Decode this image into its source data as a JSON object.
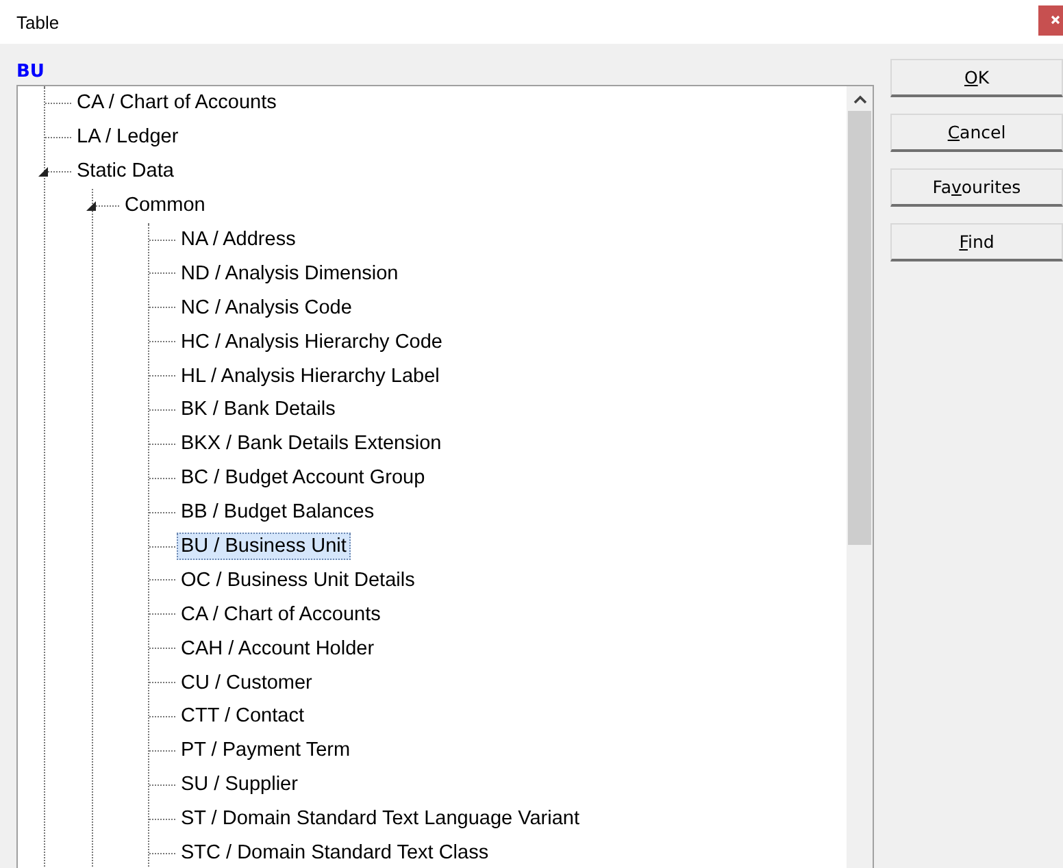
{
  "window": {
    "title": "Table"
  },
  "selection_label": "BU",
  "tree": [
    {
      "label": "CA / Chart of Accounts",
      "selected": false
    },
    {
      "label": "LA / Ledger",
      "selected": false
    },
    {
      "label": "Static Data",
      "selected": false,
      "expanded": true,
      "children": [
        {
          "label": "Common",
          "selected": false,
          "expanded": true,
          "children": [
            {
              "label": "NA / Address",
              "selected": false
            },
            {
              "label": "ND / Analysis Dimension",
              "selected": false
            },
            {
              "label": "NC / Analysis Code",
              "selected": false
            },
            {
              "label": "HC / Analysis Hierarchy Code",
              "selected": false
            },
            {
              "label": "HL / Analysis Hierarchy Label",
              "selected": false
            },
            {
              "label": "BK / Bank Details",
              "selected": false
            },
            {
              "label": "BKX / Bank Details Extension",
              "selected": false
            },
            {
              "label": "BC / Budget Account Group",
              "selected": false
            },
            {
              "label": "BB / Budget Balances",
              "selected": false
            },
            {
              "label": "BU / Business Unit",
              "selected": true
            },
            {
              "label": "OC / Business Unit Details",
              "selected": false
            },
            {
              "label": "CA / Chart of Accounts",
              "selected": false
            },
            {
              "label": "CAH / Account Holder",
              "selected": false
            },
            {
              "label": "CU / Customer",
              "selected": false
            },
            {
              "label": "CTT / Contact",
              "selected": false
            },
            {
              "label": "PT / Payment Term",
              "selected": false
            },
            {
              "label": "SU / Supplier",
              "selected": false
            },
            {
              "label": "ST / Domain Standard Text Language Variant",
              "selected": false
            },
            {
              "label": "STC / Domain Standard Text Class",
              "selected": false
            }
          ]
        }
      ]
    }
  ],
  "buttons": [
    {
      "key": "O",
      "after": "K"
    },
    {
      "key": "C",
      "after": "ancel"
    },
    {
      "before": "Fa",
      "key": "v",
      "after": "ourites"
    },
    {
      "key": "F",
      "after": "ind"
    }
  ]
}
